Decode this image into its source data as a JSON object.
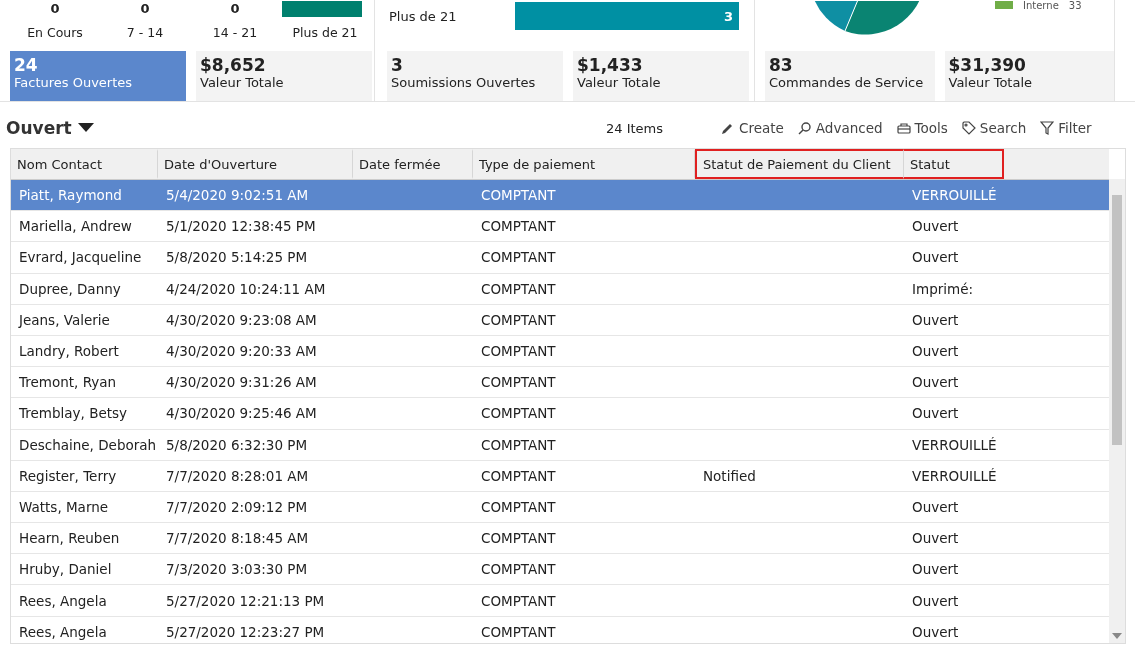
{
  "aging_panel": {
    "counts": [
      "0",
      "0",
      "0"
    ],
    "categories": [
      "En Cours",
      "7 - 14",
      "14 - 21",
      "Plus de 21"
    ],
    "tiles": [
      {
        "value": "24",
        "label": "Factures Ouvertes",
        "selected": true
      },
      {
        "value": "$8,652",
        "label": "Valeur Totale",
        "selected": false
      }
    ]
  },
  "quotes_panel": {
    "bar_label": "Plus de 21",
    "bar_value": "3",
    "tiles": [
      {
        "value": "3",
        "label": "Soumissions Ouvertes",
        "selected": false
      },
      {
        "value": "$1,433",
        "label": "Valeur Totale",
        "selected": false
      }
    ]
  },
  "service_panel": {
    "legend": {
      "label": "Interne",
      "value": "33",
      "color": "#70ad47"
    },
    "tiles": [
      {
        "value": "83",
        "label": "Commandes de Service",
        "selected": false
      },
      {
        "value": "$31,390",
        "label": "Valeur Totale",
        "selected": false
      }
    ]
  },
  "list": {
    "title": "Ouvert",
    "count": "24 Items",
    "actions": [
      {
        "kind": "pencil",
        "label": "Create"
      },
      {
        "kind": "search",
        "label": "Advanced"
      },
      {
        "kind": "tools",
        "label": "Tools"
      },
      {
        "kind": "tag",
        "label": "Search"
      },
      {
        "kind": "filter",
        "label": "Filter"
      }
    ]
  },
  "table": {
    "columns": [
      {
        "label": "Nom Contact",
        "highlighted": false
      },
      {
        "label": "Date d'Ouverture",
        "highlighted": false
      },
      {
        "label": "Date fermée",
        "highlighted": false
      },
      {
        "label": "Type de paiement",
        "highlighted": false
      },
      {
        "label": "Statut de Paiement du Client",
        "highlighted": true
      },
      {
        "label": "Statut",
        "highlighted": true
      }
    ],
    "rows": [
      {
        "selected": true,
        "cells": [
          "Piatt, Raymond",
          "5/4/2020 9:02:51 AM",
          "",
          "COMPTANT",
          "",
          "VERROUILLÉ"
        ]
      },
      {
        "selected": false,
        "cells": [
          "Mariella, Andrew",
          "5/1/2020 12:38:45 PM",
          "",
          "COMPTANT",
          "",
          "Ouvert"
        ]
      },
      {
        "selected": false,
        "cells": [
          "Evrard, Jacqueline",
          "5/8/2020 5:14:25 PM",
          "",
          "COMPTANT",
          "",
          "Ouvert"
        ]
      },
      {
        "selected": false,
        "cells": [
          "Dupree, Danny",
          "4/24/2020 10:24:11 AM",
          "",
          "COMPTANT",
          "",
          "Imprimé:"
        ]
      },
      {
        "selected": false,
        "cells": [
          "Jeans, Valerie",
          "4/30/2020 9:23:08 AM",
          "",
          "COMPTANT",
          "",
          "Ouvert"
        ]
      },
      {
        "selected": false,
        "cells": [
          "Landry, Robert",
          "4/30/2020 9:20:33 AM",
          "",
          "COMPTANT",
          "",
          "Ouvert"
        ]
      },
      {
        "selected": false,
        "cells": [
          "Tremont, Ryan",
          "4/30/2020 9:31:26 AM",
          "",
          "COMPTANT",
          "",
          "Ouvert"
        ]
      },
      {
        "selected": false,
        "cells": [
          "Tremblay, Betsy",
          "4/30/2020 9:25:46 AM",
          "",
          "COMPTANT",
          "",
          "Ouvert"
        ]
      },
      {
        "selected": false,
        "cells": [
          "Deschaine, Deborah",
          "5/8/2020 6:32:30 PM",
          "",
          "COMPTANT",
          "",
          "VERROUILLÉ"
        ]
      },
      {
        "selected": false,
        "cells": [
          "Register, Terry",
          "7/7/2020 8:28:01 AM",
          "",
          "COMPTANT",
          "Notified",
          "VERROUILLÉ"
        ]
      },
      {
        "selected": false,
        "cells": [
          "Watts, Marne",
          "7/7/2020 2:09:12 PM",
          "",
          "COMPTANT",
          "",
          "Ouvert"
        ]
      },
      {
        "selected": false,
        "cells": [
          "Hearn, Reuben",
          "7/7/2020 8:18:45 AM",
          "",
          "COMPTANT",
          "",
          "Ouvert"
        ]
      },
      {
        "selected": false,
        "cells": [
          "Hruby, Daniel",
          "7/3/2020 3:03:30 PM",
          "",
          "COMPTANT",
          "",
          "Ouvert"
        ]
      },
      {
        "selected": false,
        "cells": [
          "Rees, Angela",
          "5/27/2020 12:21:13 PM",
          "",
          "COMPTANT",
          "",
          "Ouvert"
        ]
      },
      {
        "selected": false,
        "cells": [
          "Rees, Angela",
          "5/27/2020 12:23:27 PM",
          "",
          "COMPTANT",
          "",
          "Ouvert"
        ]
      }
    ]
  }
}
